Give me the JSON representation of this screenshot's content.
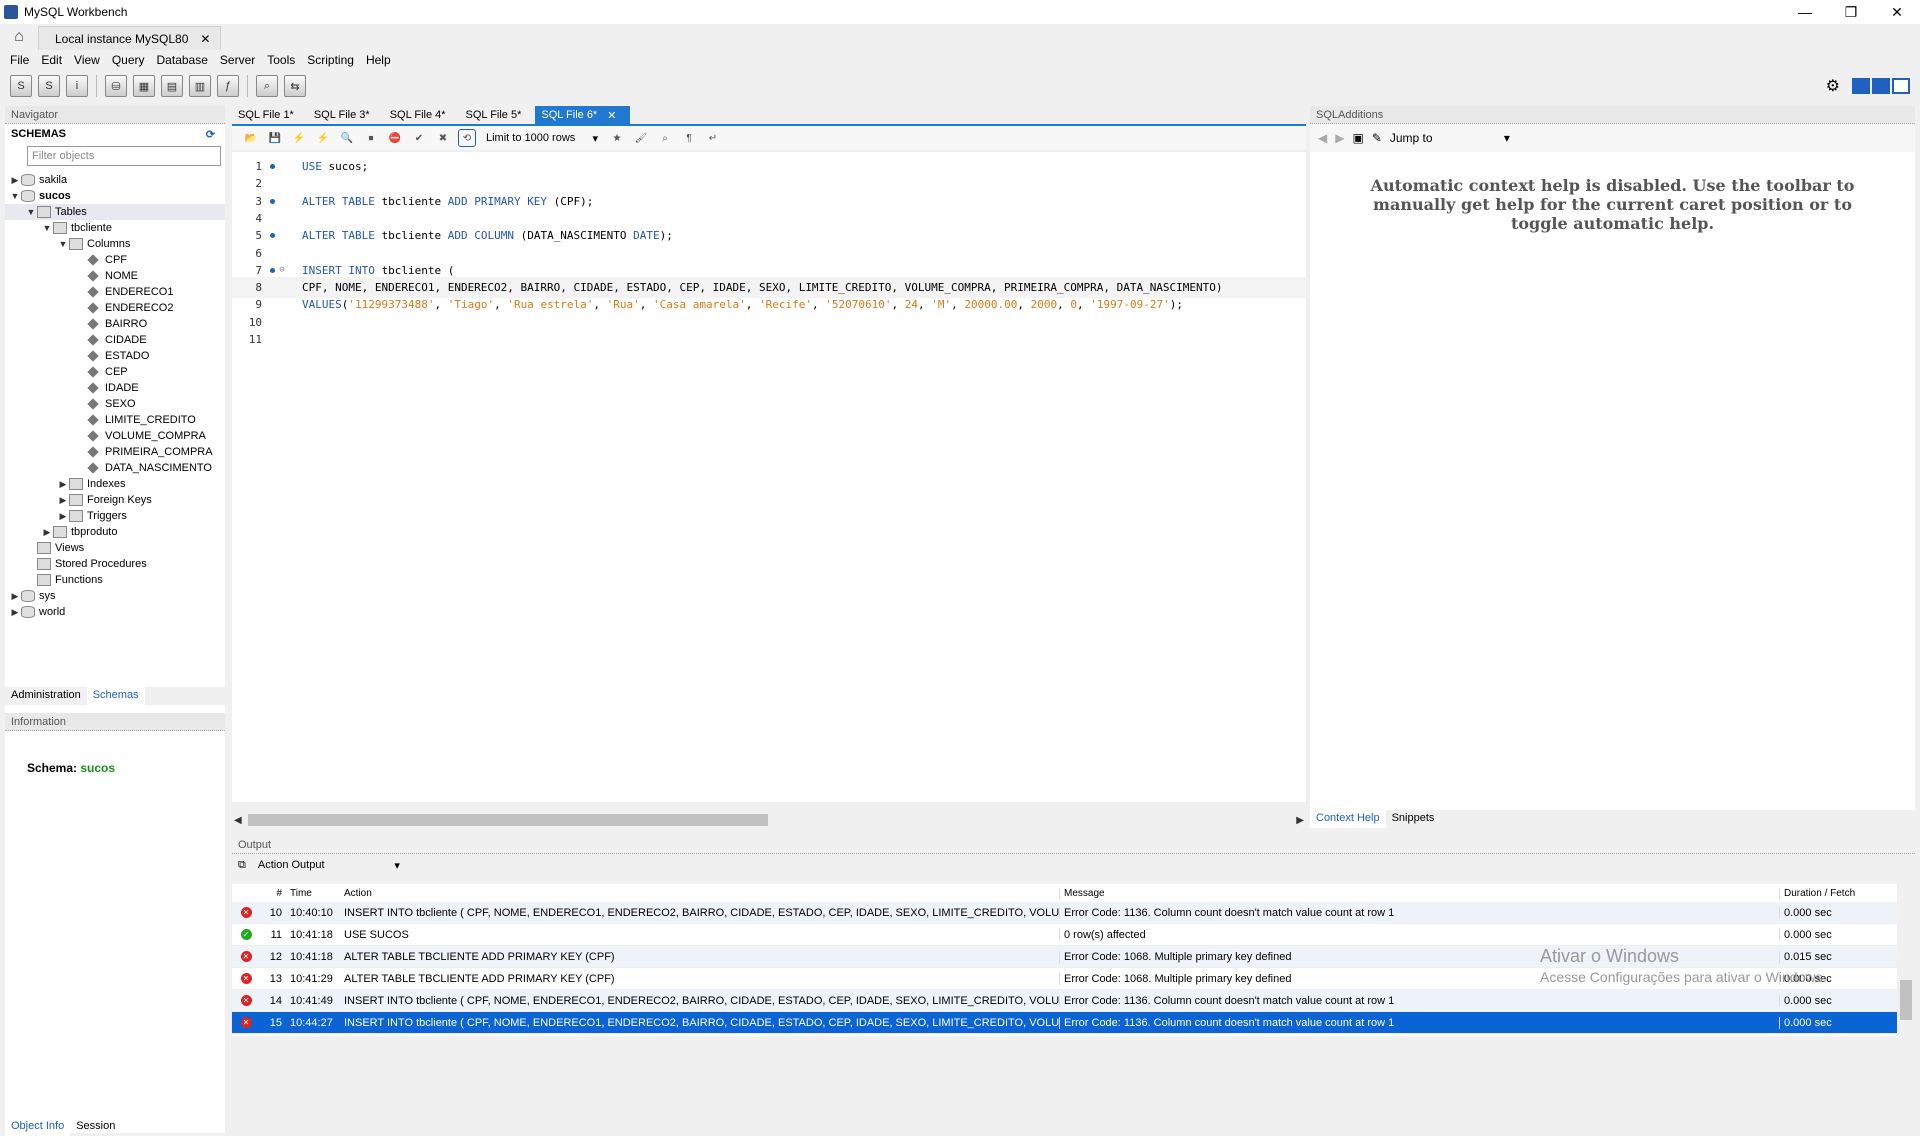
{
  "window": {
    "title": "MySQL Workbench",
    "controls": [
      "—",
      "❐",
      "✕"
    ]
  },
  "connection_tab": {
    "label": "Local instance MySQL80"
  },
  "menu": [
    "File",
    "Edit",
    "View",
    "Query",
    "Database",
    "Server",
    "Tools",
    "Scripting",
    "Help"
  ],
  "navigator": {
    "title": "Navigator",
    "schemas_label": "SCHEMAS",
    "filter_placeholder": "Filter objects",
    "tree": [
      {
        "label": "sakila",
        "level": 0,
        "type": "db",
        "arrow": "▶",
        "bold": false
      },
      {
        "label": "sucos",
        "level": 0,
        "type": "db",
        "arrow": "▼",
        "bold": true
      },
      {
        "label": "Tables",
        "level": 1,
        "type": "folder",
        "arrow": "▼",
        "bold": false,
        "selected": true
      },
      {
        "label": "tbcliente",
        "level": 2,
        "type": "table",
        "arrow": "▼",
        "bold": false
      },
      {
        "label": "Columns",
        "level": 3,
        "type": "folder",
        "arrow": "▼",
        "bold": false
      },
      {
        "label": "CPF",
        "level": 4,
        "type": "col",
        "arrow": "",
        "bold": false
      },
      {
        "label": "NOME",
        "level": 4,
        "type": "col",
        "arrow": "",
        "bold": false
      },
      {
        "label": "ENDERECO1",
        "level": 4,
        "type": "col",
        "arrow": "",
        "bold": false
      },
      {
        "label": "ENDERECO2",
        "level": 4,
        "type": "col",
        "arrow": "",
        "bold": false
      },
      {
        "label": "BAIRRO",
        "level": 4,
        "type": "col",
        "arrow": "",
        "bold": false
      },
      {
        "label": "CIDADE",
        "level": 4,
        "type": "col",
        "arrow": "",
        "bold": false
      },
      {
        "label": "ESTADO",
        "level": 4,
        "type": "col",
        "arrow": "",
        "bold": false
      },
      {
        "label": "CEP",
        "level": 4,
        "type": "col",
        "arrow": "",
        "bold": false
      },
      {
        "label": "IDADE",
        "level": 4,
        "type": "col",
        "arrow": "",
        "bold": false
      },
      {
        "label": "SEXO",
        "level": 4,
        "type": "col",
        "arrow": "",
        "bold": false
      },
      {
        "label": "LIMITE_CREDITO",
        "level": 4,
        "type": "col",
        "arrow": "",
        "bold": false
      },
      {
        "label": "VOLUME_COMPRA",
        "level": 4,
        "type": "col",
        "arrow": "",
        "bold": false
      },
      {
        "label": "PRIMEIRA_COMPRA",
        "level": 4,
        "type": "col",
        "arrow": "",
        "bold": false
      },
      {
        "label": "DATA_NASCIMENTO",
        "level": 4,
        "type": "col",
        "arrow": "",
        "bold": false
      },
      {
        "label": "Indexes",
        "level": 3,
        "type": "folder",
        "arrow": "▶",
        "bold": false
      },
      {
        "label": "Foreign Keys",
        "level": 3,
        "type": "folder",
        "arrow": "▶",
        "bold": false
      },
      {
        "label": "Triggers",
        "level": 3,
        "type": "folder",
        "arrow": "▶",
        "bold": false
      },
      {
        "label": "tbproduto",
        "level": 2,
        "type": "table",
        "arrow": "▶",
        "bold": false
      },
      {
        "label": "Views",
        "level": 1,
        "type": "folder",
        "arrow": "",
        "bold": false
      },
      {
        "label": "Stored Procedures",
        "level": 1,
        "type": "folder",
        "arrow": "",
        "bold": false
      },
      {
        "label": "Functions",
        "level": 1,
        "type": "folder",
        "arrow": "",
        "bold": false
      },
      {
        "label": "sys",
        "level": 0,
        "type": "db",
        "arrow": "▶",
        "bold": false
      },
      {
        "label": "world",
        "level": 0,
        "type": "db",
        "arrow": "▶",
        "bold": false
      }
    ],
    "bottom_tabs": [
      "Administration",
      "Schemas"
    ],
    "info_title": "Information",
    "schema_label": "Schema:",
    "schema_value": "sucos",
    "info_tabs": [
      "Object Info",
      "Session"
    ]
  },
  "editor": {
    "file_tabs": [
      "SQL File 1*",
      "SQL File 3*",
      "SQL File 4*",
      "SQL File 5*",
      "SQL File 6*"
    ],
    "active_tab_close": "✕",
    "limit_label": "Limit to 1000 rows",
    "lines": [
      {
        "n": "1",
        "dot": true,
        "fold": "",
        "hl": false,
        "parts": [
          [
            "kw",
            "USE"
          ],
          [
            "t",
            " sucos;"
          ]
        ]
      },
      {
        "n": "2",
        "dot": false,
        "fold": "",
        "hl": false,
        "parts": []
      },
      {
        "n": "3",
        "dot": true,
        "fold": "",
        "hl": false,
        "parts": [
          [
            "kw",
            "ALTER TABLE"
          ],
          [
            "t",
            " tbcliente "
          ],
          [
            "kw",
            "ADD PRIMARY KEY"
          ],
          [
            "t",
            " (CPF);"
          ]
        ]
      },
      {
        "n": "4",
        "dot": false,
        "fold": "",
        "hl": false,
        "parts": []
      },
      {
        "n": "5",
        "dot": true,
        "fold": "",
        "hl": false,
        "parts": [
          [
            "kw",
            "ALTER TABLE"
          ],
          [
            "t",
            " tbcliente "
          ],
          [
            "kw",
            "ADD COLUMN"
          ],
          [
            "t",
            " (DATA_NASCIMENTO "
          ],
          [
            "kw",
            "DATE"
          ],
          [
            "t",
            ");"
          ]
        ]
      },
      {
        "n": "6",
        "dot": false,
        "fold": "",
        "hl": false,
        "parts": []
      },
      {
        "n": "7",
        "dot": true,
        "fold": "⊖",
        "hl": false,
        "parts": [
          [
            "kw",
            "INSERT INTO"
          ],
          [
            "t",
            " tbcliente ("
          ]
        ]
      },
      {
        "n": "8",
        "dot": false,
        "fold": "",
        "hl": true,
        "parts": [
          [
            "t",
            "CPF, NOME, ENDERECO1, ENDERECO2, BAIRRO, CIDADE, ESTADO, CEP, IDADE, SEXO, LIMITE_CREDITO, VOLUME_COMPRA, PRIMEIRA_COMPRA, DATA_NASCIMENTO)"
          ]
        ]
      },
      {
        "n": "9",
        "dot": false,
        "fold": "",
        "hl": false,
        "parts": [
          [
            "kw",
            "VALUES"
          ],
          [
            "t",
            "("
          ],
          [
            "str",
            "'11299373488'"
          ],
          [
            "t",
            ", "
          ],
          [
            "str",
            "'Tiago'"
          ],
          [
            "t",
            ", "
          ],
          [
            "str",
            "'Rua estrela'"
          ],
          [
            "t",
            ", "
          ],
          [
            "str",
            "'Rua'"
          ],
          [
            "t",
            ", "
          ],
          [
            "str",
            "'Casa amarela'"
          ],
          [
            "t",
            ", "
          ],
          [
            "str",
            "'Recife'"
          ],
          [
            "t",
            ", "
          ],
          [
            "str",
            "'52070610'"
          ],
          [
            "t",
            ", "
          ],
          [
            "num",
            "24"
          ],
          [
            "t",
            ", "
          ],
          [
            "str",
            "'M'"
          ],
          [
            "t",
            ", "
          ],
          [
            "num",
            "20000.00"
          ],
          [
            "t",
            ", "
          ],
          [
            "num",
            "2000"
          ],
          [
            "t",
            ", "
          ],
          [
            "num",
            "0"
          ],
          [
            "t",
            ", "
          ],
          [
            "str",
            "'1997-09-27'"
          ],
          [
            "t",
            ");"
          ]
        ]
      },
      {
        "n": "10",
        "dot": false,
        "fold": "",
        "hl": false,
        "parts": []
      },
      {
        "n": "11",
        "dot": false,
        "fold": "",
        "hl": false,
        "parts": []
      }
    ]
  },
  "sql_additions": {
    "title": "SQLAdditions",
    "jump_to": "Jump to",
    "help_text": "Automatic context help is disabled. Use the toolbar to manually get help for the current caret position or to toggle automatic help.",
    "tabs": [
      "Context Help",
      "Snippets"
    ]
  },
  "output": {
    "title": "Output",
    "selector": "Action Output",
    "columns": [
      "#",
      "Time",
      "Action",
      "Message",
      "Duration / Fetch"
    ],
    "rows": [
      {
        "status": "err",
        "num": "10",
        "time": "10:40:10",
        "action": "INSERT INTO tbcliente ( CPF, NOME, ENDERECO1, ENDERECO2, BAIRRO, CIDADE, ESTADO, CEP, IDADE, SEXO, LIMITE_CREDITO, VOLU...",
        "message": "Error Code: 1136. Column count doesn't match value count at row 1",
        "duration": "0.000 sec"
      },
      {
        "status": "ok",
        "num": "11",
        "time": "10:41:18",
        "action": "USE SUCOS",
        "message": "0 row(s) affected",
        "duration": "0.000 sec"
      },
      {
        "status": "err",
        "num": "12",
        "time": "10:41:18",
        "action": "ALTER TABLE TBCLIENTE ADD PRIMARY KEY (CPF)",
        "message": "Error Code: 1068. Multiple primary key defined",
        "duration": "0.015 sec"
      },
      {
        "status": "err",
        "num": "13",
        "time": "10:41:29",
        "action": "ALTER TABLE TBCLIENTE ADD PRIMARY KEY (CPF)",
        "message": "Error Code: 1068. Multiple primary key defined",
        "duration": "0.000 sec"
      },
      {
        "status": "err",
        "num": "14",
        "time": "10:41:49",
        "action": "INSERT INTO tbcliente ( CPF, NOME, ENDERECO1, ENDERECO2, BAIRRO, CIDADE, ESTADO, CEP, IDADE, SEXO, LIMITE_CREDITO, VOLU...",
        "message": "Error Code: 1136. Column count doesn't match value count at row 1",
        "duration": "0.000 sec"
      },
      {
        "status": "err",
        "num": "15",
        "time": "10:44:27",
        "action": "INSERT INTO tbcliente ( CPF, NOME, ENDERECO1, ENDERECO2, BAIRRO, CIDADE, ESTADO, CEP, IDADE, SEXO, LIMITE_CREDITO, VOLU...",
        "message": "Error Code: 1136. Column count doesn't match value count at row 1",
        "duration": "0.000 sec"
      }
    ]
  },
  "watermark": {
    "title": "Ativar o Windows",
    "subtitle": "Acesse Configurações para ativar o Windows."
  },
  "colors": {
    "accent": "#2078d0",
    "selected_row": "#0a64d6",
    "keyword": "#2456b3",
    "string": "#d97a16",
    "error": "#dd2222",
    "ok": "#22aa22"
  }
}
